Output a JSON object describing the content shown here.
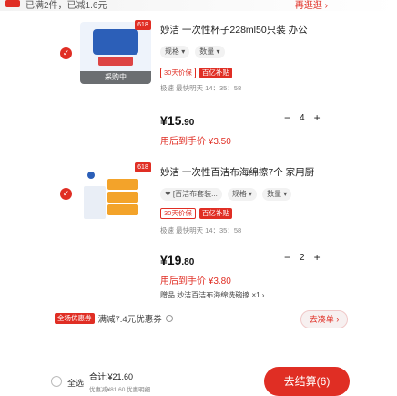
{
  "header": {
    "left_text": "已满2件，已减1.6元",
    "right_text": "再逛逛 ›"
  },
  "items": [
    {
      "tag": "618",
      "thumb_label": "采购中",
      "title": "妙洁 一次性杯子228ml50只装 办公",
      "chips": [
        "规格 ▾",
        "数量 ▾"
      ],
      "promo_tags": [
        "30天价保",
        "百亿补贴"
      ],
      "ship": "极速 最快明天 14：35：58",
      "price_main": "¥15",
      "price_decimal": ".90",
      "after_price": "用后到手价 ¥3.50",
      "minus": "−",
      "qty": "4",
      "plus": "+"
    },
    {
      "tag": "618",
      "title": "妙洁 一次性百洁布海绵擦7个 家用厨",
      "chips": [
        "❤ [百洁布套装...",
        "规格 ▾",
        "数量 ▾"
      ],
      "promo_tags": [
        "30天价保",
        "百亿补贴"
      ],
      "ship": "极速 最快明天 14：35：58",
      "price_main": "¥19",
      "price_decimal": ".80",
      "after_price": "用后到手价 ¥3.80",
      "minus": "−",
      "qty": "2",
      "plus": "+",
      "note": "赠品 妙洁百洁布海绵洗碗擦 ×1 ›"
    }
  ],
  "bottom": {
    "coupon_badge": "全场优惠券",
    "coupon_text": "满减7.4元优惠券",
    "toggle_label": "去凑单 ›",
    "select_all": "全选",
    "total": "合计:¥21.60",
    "saved": "优惠减¥81.60  优惠明细",
    "pay_label": "去结算(6)"
  },
  "colors": {
    "accent": "#e02e24"
  }
}
